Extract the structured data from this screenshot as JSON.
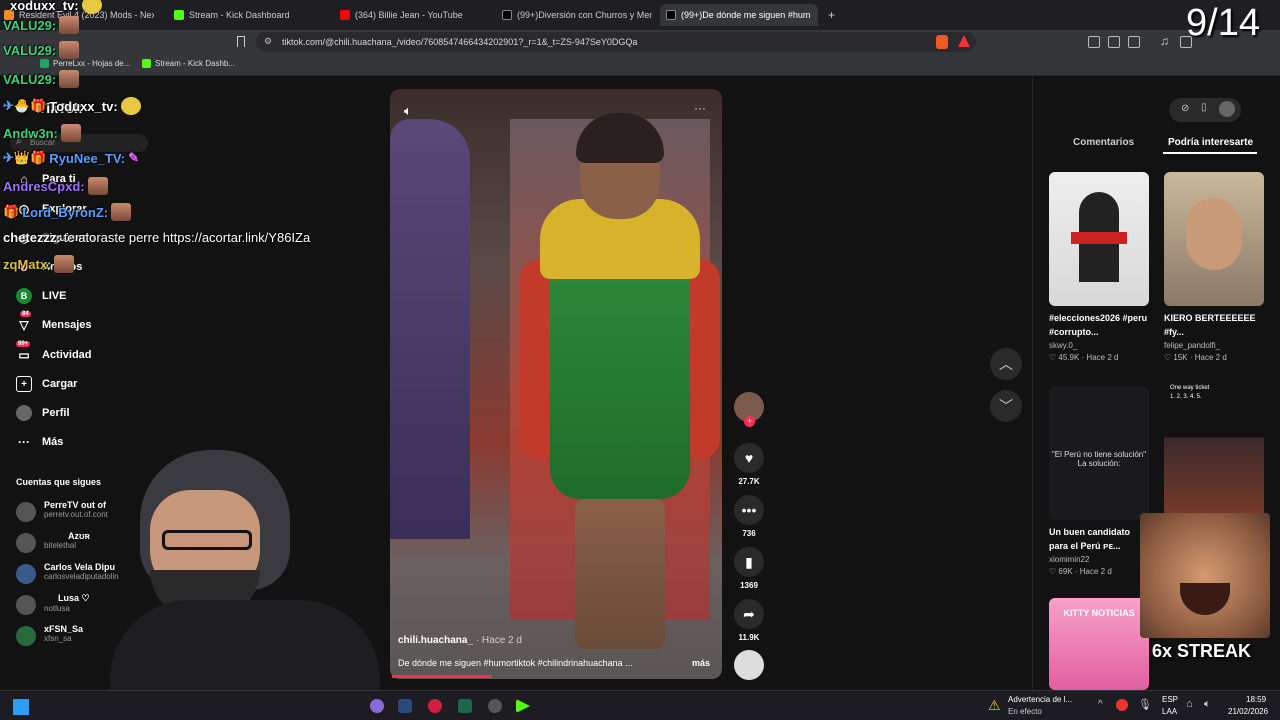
{
  "browser": {
    "tabs": [
      {
        "label": "Resident Evil 4 (2023) Mods - Nexus"
      },
      {
        "label": "Stream - Kick Dashboard"
      },
      {
        "label": "(364) Billie Jean - YouTube"
      },
      {
        "label": "(99+)Diversión con Churros y Meme"
      },
      {
        "label": "(99+)De dónde me siguen #hum",
        "active": true
      }
    ],
    "url": "tiktok.com/@chili.huachana_/video/7608547466434202901?_r=1&_t=ZS-947SeY0DGQa",
    "bookmarks": [
      {
        "label": "PerreLxx - Hojas de..."
      },
      {
        "label": "Stream - Kick Dashb..."
      }
    ]
  },
  "overlay": {
    "counter": "9/14",
    "streak": "6x STREAK"
  },
  "chat": [
    {
      "user": "xoduxx_tv:",
      "color": "#ffffff",
      "text": ""
    },
    {
      "user": "VALU29:",
      "color": "#37d67a",
      "text": ""
    },
    {
      "user": "VALU29:",
      "color": "#37d67a",
      "text": ""
    },
    {
      "user": "VALU29:",
      "color": "#37d67a",
      "text": ""
    },
    {
      "user": "Toduxx_tv:",
      "color": "#ffffff",
      "text": ""
    },
    {
      "user": "Andw3n:",
      "color": "#37d67a",
      "text": ""
    },
    {
      "user": "RyuNee_TV:",
      "color": "#5aa0ff",
      "text": ""
    },
    {
      "user": "AndresCpxd:",
      "color": "#a070ff",
      "text": ""
    },
    {
      "user": "Lord_ByronZ:",
      "color": "#5aa0ff",
      "text": ""
    },
    {
      "user": "chetezzz:",
      "color": "#ffffff",
      "text": "te atoraste perre https://acortar.link/Y86IZa"
    },
    {
      "user": "zqMatx:",
      "color": "#e0c040",
      "text": ""
    }
  ],
  "tiktok": {
    "logo": "TikTok",
    "search_placeholder": "Buscar",
    "nav": [
      {
        "label": "Para ti",
        "icon": "home-icon"
      },
      {
        "label": "Explorar",
        "icon": "compass-icon"
      },
      {
        "label": "Siguiendo",
        "icon": "following-icon"
      },
      {
        "label": "Amigos",
        "icon": "friends-icon"
      },
      {
        "label": "LIVE",
        "icon": "live-icon"
      },
      {
        "label": "Mensajes",
        "icon": "messages-icon",
        "badge": "84"
      },
      {
        "label": "Actividad",
        "icon": "activity-icon",
        "badge": "99+"
      },
      {
        "label": "Cargar",
        "icon": "upload-icon"
      },
      {
        "label": "Perfil",
        "icon": "profile-icon"
      },
      {
        "label": "Más",
        "icon": "more-icon"
      }
    ],
    "following_title": "Cuentas que sigues",
    "following": [
      {
        "name": "PerreTV out of",
        "handle": "perretv.out.of.cont"
      },
      {
        "name": "Azʊʀ",
        "handle": "bitelethal"
      },
      {
        "name": "Carlos Vela Dipu",
        "handle": "carlosveladiputadolin"
      },
      {
        "name": "Lusa ♡",
        "handle": "notlusa"
      },
      {
        "name": "xFSN_Sa",
        "handle": "xfsn_sa"
      }
    ],
    "video": {
      "author": "chili.huachana_",
      "time": " · Hace 2 d",
      "caption": "De dónde me siguen #humortiktok #chilindrinahuachana ...",
      "more": "más"
    },
    "actions": {
      "likes": "27.7K",
      "comments": "736",
      "saves": "1369",
      "shares": "11.9K"
    },
    "right_tabs": {
      "comments": "Comentarios",
      "suggested": "Podría interesarte"
    },
    "cards": [
      {
        "title": "#elecciones2026 #peru #corrupto...",
        "user": "skwy.0_",
        "likes": "45.9K",
        "time": "Hace 2 d",
        "thumb_text": ""
      },
      {
        "title": "KIERO BERTEEEEEE #fy...",
        "user": "felipe_pandolfi_",
        "likes": "15K",
        "time": "Hace 2 d",
        "thumb_text": ""
      },
      {
        "title": "Un buen candidato para el Perú ᴘᴇ...",
        "user": "xiomimin22",
        "likes": "69K",
        "time": "Hace 2 d",
        "thumb_text": "\"El Perú no tiene solución\" La solución:"
      },
      {
        "title": "",
        "user": "",
        "likes": "",
        "time": "",
        "thumb_text": "One way ticket 1. 2. 3. 4. 5."
      }
    ],
    "card5_thumb": "KITTY NOTICIAS"
  },
  "taskbar": {
    "notice_title": "Advertencia de l...",
    "notice_sub": "En efecto",
    "lang": "ESP",
    "lang_sub": "LAA",
    "time": "18:59",
    "date": "21/02/2026"
  },
  "colors": {
    "accent": "#fe2c55",
    "bg": "#121212"
  }
}
